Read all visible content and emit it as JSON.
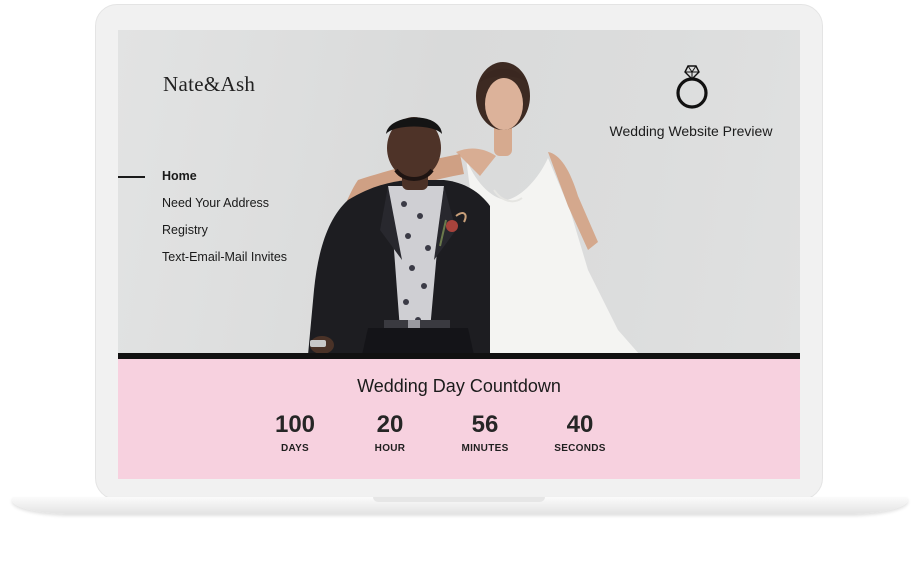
{
  "site": {
    "brand": "Nate&Ash",
    "preview_label": "Wedding Website Preview",
    "nav": [
      {
        "label": "Home",
        "active": true
      },
      {
        "label": "Need Your Address",
        "active": false
      },
      {
        "label": "Registry",
        "active": false
      },
      {
        "label": "Text-Email-Mail Invites",
        "active": false
      }
    ]
  },
  "countdown": {
    "title": "Wedding Day Countdown",
    "units": [
      {
        "value": "100",
        "label": "DAYS"
      },
      {
        "value": "20",
        "label": "HOUR"
      },
      {
        "value": "56",
        "label": "MINUTES"
      },
      {
        "value": "40",
        "label": "SECONDS"
      }
    ]
  },
  "colors": {
    "countdown_bg": "#f7d1df",
    "divider": "#111111",
    "hero_bg": "#dcdddd"
  },
  "icons": {
    "ring": "ring-icon",
    "photo": "couple-photo"
  }
}
